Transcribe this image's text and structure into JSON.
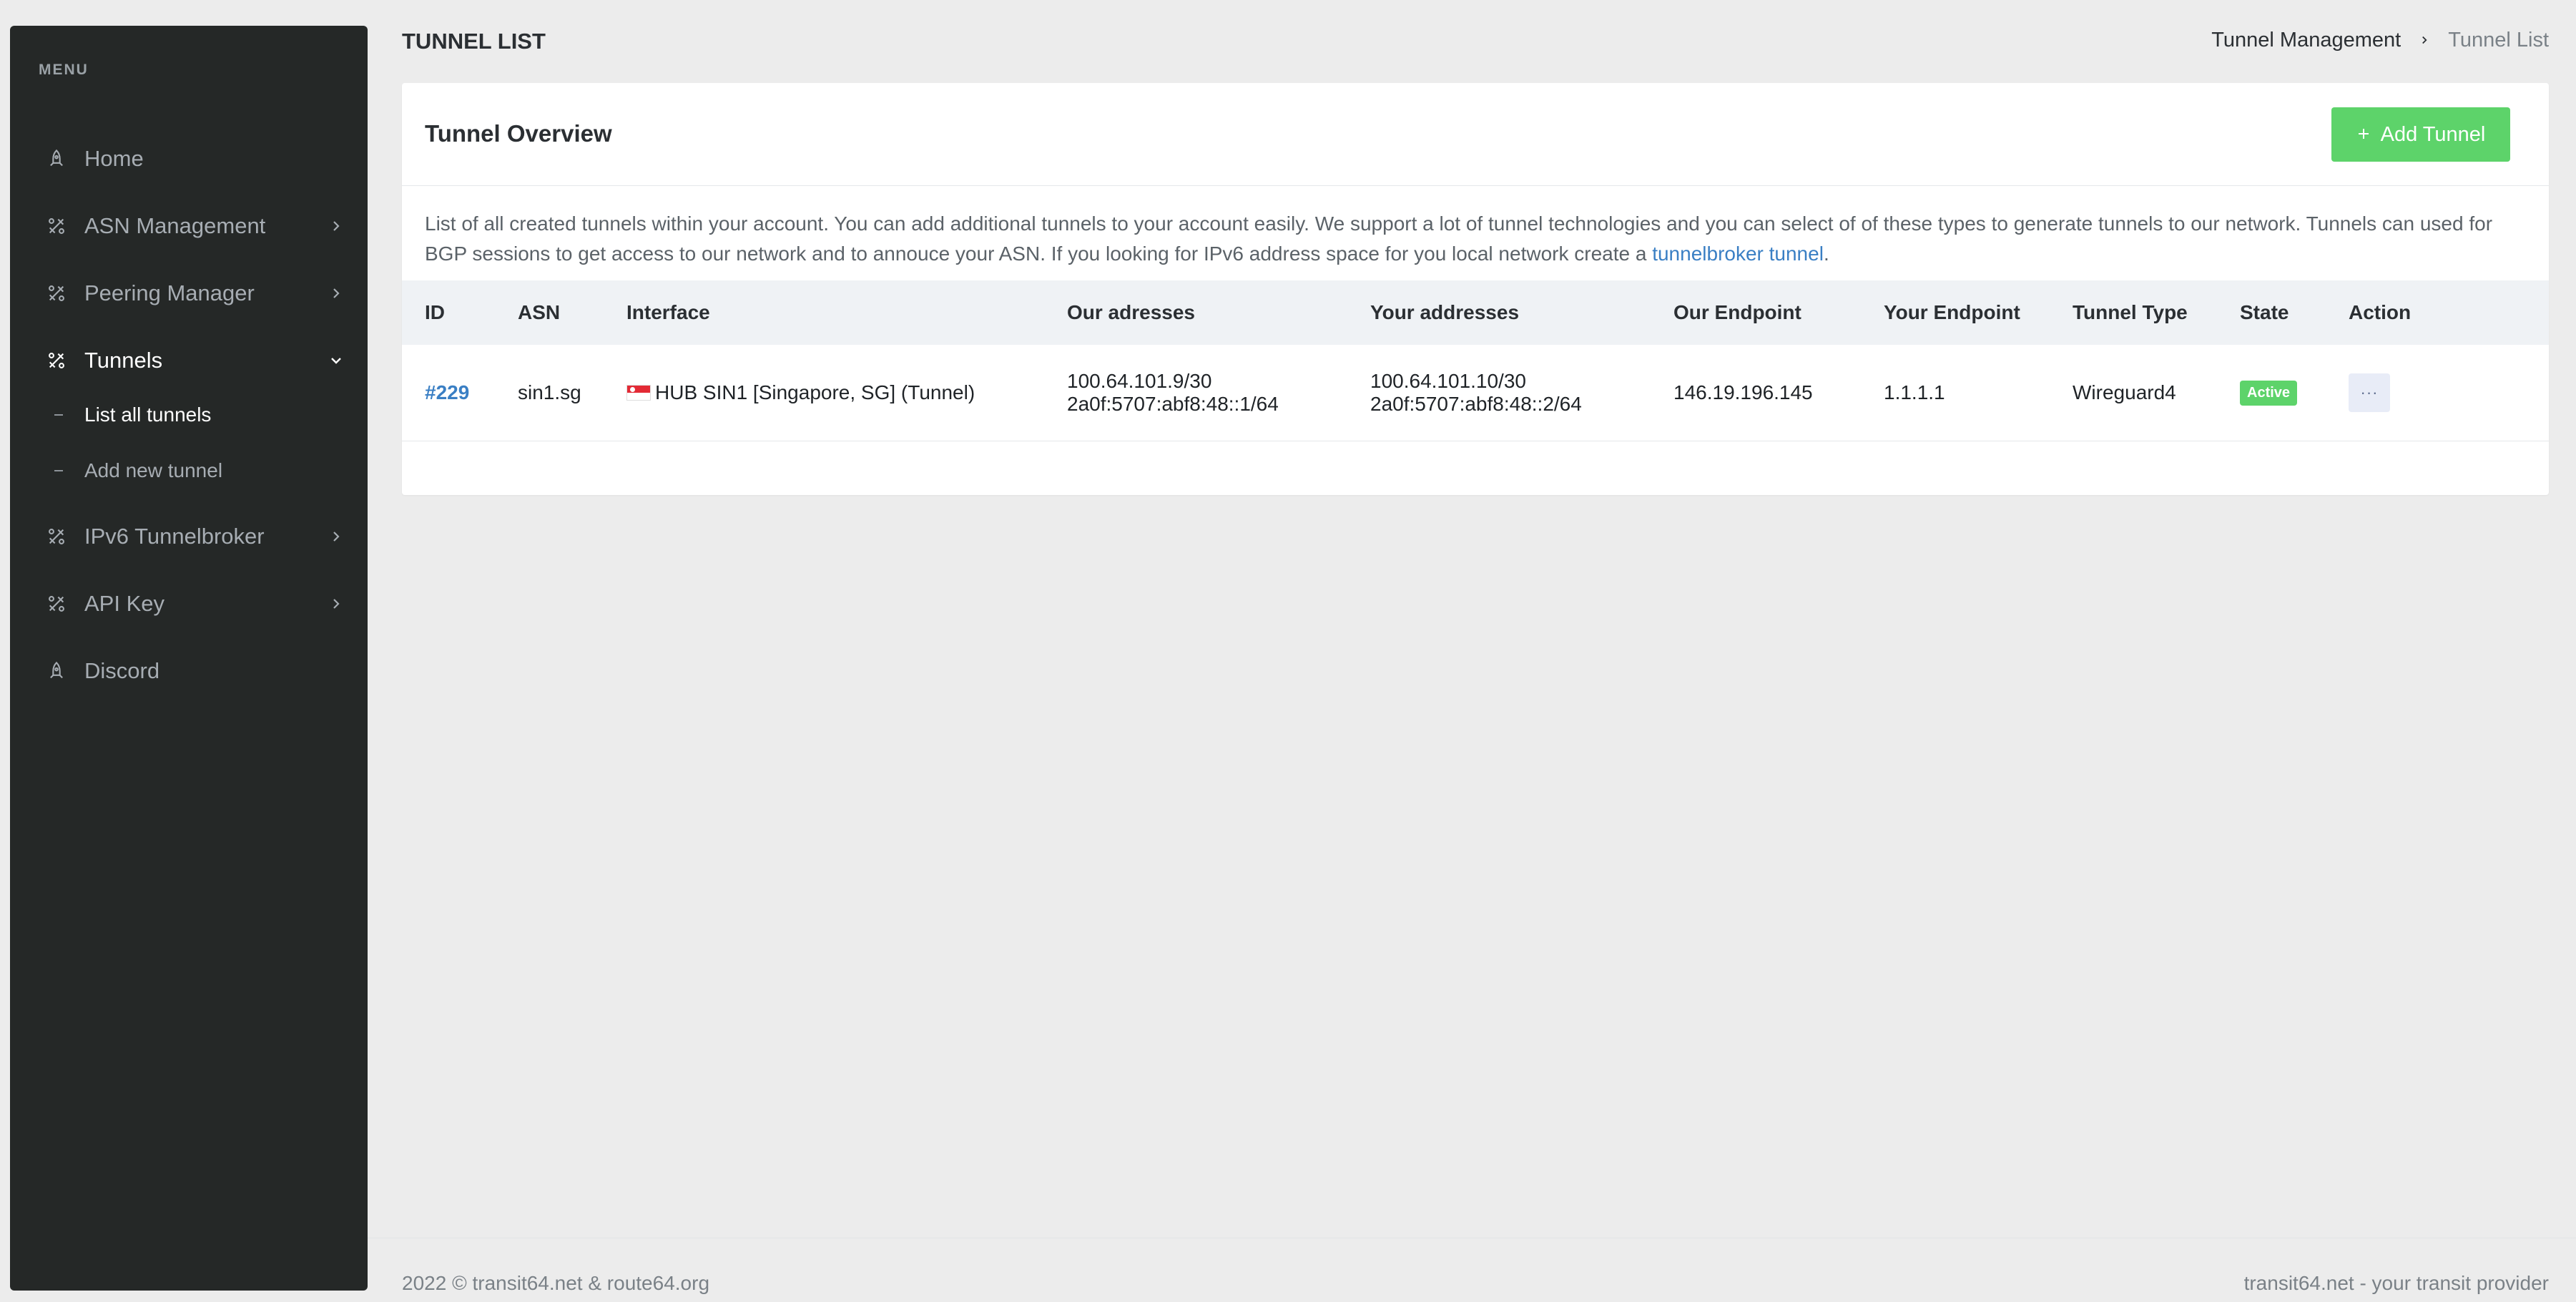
{
  "sidebar": {
    "menu_title": "MENU",
    "items": [
      {
        "label": "Home",
        "icon": "rocket-icon"
      },
      {
        "label": "ASN Management",
        "icon": "tools-icon"
      },
      {
        "label": "Peering Manager",
        "icon": "tools-icon"
      },
      {
        "label": "Tunnels",
        "icon": "tools-icon"
      },
      {
        "label": "IPv6 Tunnelbroker",
        "icon": "tools-icon"
      },
      {
        "label": "API Key",
        "icon": "tools-icon"
      },
      {
        "label": "Discord",
        "icon": "rocket-icon"
      }
    ],
    "sub_items": [
      {
        "label": "List all tunnels"
      },
      {
        "label": "Add new tunnel"
      }
    ]
  },
  "header": {
    "title": "TUNNEL LIST",
    "breadcrumb": [
      "Tunnel Management",
      "Tunnel List"
    ]
  },
  "card": {
    "title": "Tunnel Overview",
    "add_button": "Add Tunnel",
    "description": "List of all created tunnels within your account. You can add additional tunnels to your account easily. We support a lot of tunnel technologies and you can select of of these types to generate tunnels to our network. Tunnels can used for BGP sessions to get access to our network and to annouce your ASN. If you looking for IPv6 address space for you local network create a ",
    "description_link": "tunnelbroker tunnel",
    "description_end": "."
  },
  "table": {
    "columns": [
      "ID",
      "ASN",
      "Interface",
      "Our adresses",
      "Your addresses",
      "Our Endpoint",
      "Your Endpoint",
      "Tunnel Type",
      "State",
      "Action"
    ],
    "rows": [
      {
        "id": "#229",
        "asn": "sin1.sg",
        "interface": "HUB SIN1 [Singapore, SG] (Tunnel)",
        "our_v4": "100.64.101.9/30",
        "our_v6": "2a0f:5707:abf8:48::1/64",
        "your_v4": "100.64.101.10/30",
        "your_v6": "2a0f:5707:abf8:48::2/64",
        "our_endpoint": "146.19.196.145",
        "your_endpoint": "1.1.1.1",
        "tunnel_type": "Wireguard4",
        "state": "Active",
        "action": "···"
      }
    ]
  },
  "footer": {
    "left": "2022 © transit64.net & route64.org",
    "right": "transit64.net - your transit provider"
  },
  "colors": {
    "sidebar_bg": "#252827",
    "accent_green": "#5dd36a",
    "link_blue": "#3a7fc4"
  }
}
